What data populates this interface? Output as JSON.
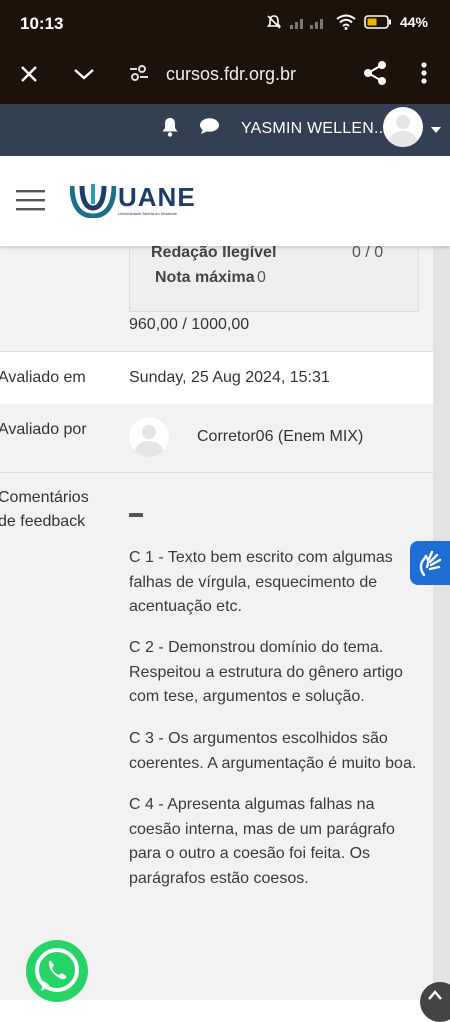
{
  "status": {
    "time": "10:13",
    "battery": "44%"
  },
  "browser": {
    "url": "cursos.fdr.org.br"
  },
  "nav": {
    "user_name": "YASMIN WELLEN..."
  },
  "brand": {
    "logo_text": "UANE",
    "logo_subtext": "Universidade Aberta do Nordeste"
  },
  "grade_box": {
    "illegible_label": "Redação Ilegível",
    "illegible_value": "0 / 0",
    "max_label": "Nota máxima",
    "max_value": "0"
  },
  "grade_total": "960,00 / 1000,00",
  "evaluated_on": {
    "label": "Avaliado em",
    "value": "Sunday, 25 Aug 2024, 15:31"
  },
  "evaluated_by": {
    "label": "Avaliado por",
    "value": "Corretor06 (Enem MIX)"
  },
  "feedback": {
    "label_line1": "Comentários",
    "label_line2": "de feedback",
    "paragraphs": [
      "C 1 - Texto bem escrito com algumas\nfalhas de vírgula, esquecimento de\nacentuação etc.",
      " C 2 - Demonstrou domínio do tema.\nRespeitou a estrutura do gênero artigo\ncom tese, argumentos e solução.",
      "C 3 - Os argumentos escolhidos são\ncoerentes. A argumentação é muito boa.",
      "C 4 - Apresenta algumas falhas na\ncoesão interna, mas de um parágrafo\npara o outro a coesão foi feita. Os\nparágrafos estão coesos."
    ]
  },
  "colors": {
    "nav_bg": "#333f52",
    "brand_teal": "#1b6f8a",
    "brand_navy": "#1f3b6b",
    "whatsapp": "#25d366",
    "a11y_blue": "#1d6fd6"
  }
}
